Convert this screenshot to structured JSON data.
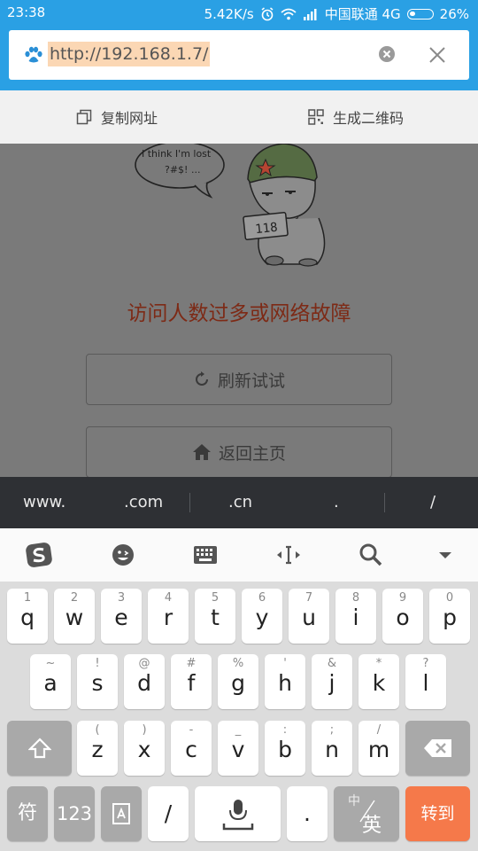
{
  "status_bar": {
    "time": "23:38",
    "network_speed": "5.42K/s",
    "carrier": "中国联通 4G",
    "battery": "26%",
    "icons": [
      "alarm-icon",
      "wifi-icon",
      "signal-icon",
      "battery-icon"
    ]
  },
  "url_bar": {
    "url": "http://192.168.1.7/",
    "icons": [
      "paw-icon",
      "clear-icon",
      "close-icon"
    ]
  },
  "actions": {
    "copy_label": "复制网址",
    "qr_label": "生成二维码"
  },
  "page": {
    "bubble_line1": "I think I'm lost",
    "bubble_line2": "?#$! ...",
    "mascot_sign": "118",
    "error_title": "访问人数过多或网络故障",
    "refresh_label": "刷新试试",
    "home_label": "返回主页"
  },
  "suggestions": [
    "www.",
    ".com",
    ".cn",
    ".",
    "/"
  ],
  "keyboard_toolbar": [
    "sogou-logo-icon",
    "emoji-icon",
    "keyboard-icon",
    "cursor-icon",
    "search-icon",
    "collapse-icon"
  ],
  "keyboard": {
    "row1": [
      {
        "sub": "1",
        "main": "q"
      },
      {
        "sub": "2",
        "main": "w"
      },
      {
        "sub": "3",
        "main": "e"
      },
      {
        "sub": "4",
        "main": "r"
      },
      {
        "sub": "5",
        "main": "t"
      },
      {
        "sub": "6",
        "main": "y"
      },
      {
        "sub": "7",
        "main": "u"
      },
      {
        "sub": "8",
        "main": "i"
      },
      {
        "sub": "9",
        "main": "o"
      },
      {
        "sub": "0",
        "main": "p"
      }
    ],
    "row2": [
      {
        "sub": "~",
        "main": "a"
      },
      {
        "sub": "!",
        "main": "s"
      },
      {
        "sub": "@",
        "main": "d"
      },
      {
        "sub": "#",
        "main": "f"
      },
      {
        "sub": "%",
        "main": "g"
      },
      {
        "sub": "'",
        "main": "h"
      },
      {
        "sub": "&",
        "main": "j"
      },
      {
        "sub": "*",
        "main": "k"
      },
      {
        "sub": "?",
        "main": "l"
      }
    ],
    "row3": [
      {
        "sub": "(",
        "main": "z"
      },
      {
        "sub": ")",
        "main": "x"
      },
      {
        "sub": "-",
        "main": "c"
      },
      {
        "sub": "_",
        "main": "v"
      },
      {
        "sub": ":",
        "main": "b"
      },
      {
        "sub": ";",
        "main": "n"
      },
      {
        "sub": "/",
        "main": "m"
      }
    ],
    "symbol_key": "符",
    "number_key": "123",
    "slash_key": "/",
    "dot_key": ".",
    "lang_key_top": "中",
    "lang_key_main": "英",
    "go_key": "转到"
  },
  "colors": {
    "header_blue": "#2aa0e4",
    "url_highlight": "#fbd7b4",
    "error_text": "#7d2a16",
    "go_key": "#f5794a"
  }
}
